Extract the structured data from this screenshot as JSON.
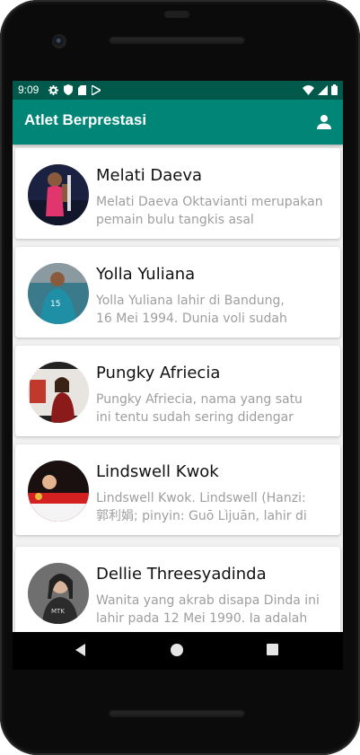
{
  "status_bar": {
    "time": "9:09",
    "left_icons": [
      "gear-icon",
      "shield-icon",
      "sd-card-icon",
      "play-store-icon"
    ],
    "right_icons": [
      "wifi-icon",
      "signal-icon",
      "battery-icon"
    ]
  },
  "app_bar": {
    "title": "Atlet Berprestasi",
    "action_icon": "person-icon",
    "color": "#008577",
    "status_color": "#00594a"
  },
  "athletes": [
    {
      "name": "Melati Daeva",
      "desc_line1": "Melati Daeva Oktavianti merupakan",
      "desc_line2": "pemain bulu tangkis asal"
    },
    {
      "name": "Yolla Yuliana",
      "desc_line1": "Yolla Yuliana lahir di Bandung,",
      "desc_line2": "16 Mei 1994. Dunia voli sudah"
    },
    {
      "name": "Pungky Afriecia",
      "desc_line1": "Pungky Afriecia, nama yang satu",
      "desc_line2": "ini tentu sudah sering didengar"
    },
    {
      "name": "Lindswell Kwok",
      "desc_line1": "Lindswell Kwok. Lindswell (Hanzi:",
      "desc_line2": "郭利娟; pinyin: Guō Lìjuān, lahir di"
    },
    {
      "name": "Dellie Threesyadinda",
      "desc_line1": "Wanita yang akrab disapa Dinda ini",
      "desc_line2": "lahir pada 12 Mei 1990. Ia adalah"
    }
  ],
  "nav": {
    "back_icon": "back-triangle-icon",
    "home_icon": "home-circle-icon",
    "recent_icon": "recent-square-icon"
  }
}
